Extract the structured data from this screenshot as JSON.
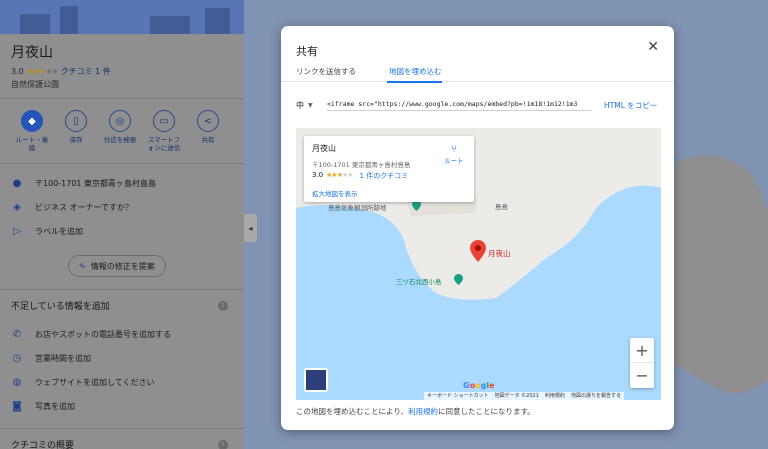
{
  "left_panel": {
    "title": "月夜山",
    "rating": "3.0",
    "review_link": "クチコミ 1 件",
    "category": "自然保護公園",
    "actions": [
      {
        "label_1": "ルート・乗",
        "label_2": "換",
        "icon": "directions-icon"
      },
      {
        "label_1": "保存",
        "label_2": "",
        "icon": "bookmark-icon"
      },
      {
        "label_1": "付近を検索",
        "label_2": "",
        "icon": "nearby-icon"
      },
      {
        "label_1": "スマートフ",
        "label_2": "ォンに送信",
        "icon": "phone-icon"
      },
      {
        "label_1": "共有",
        "label_2": "",
        "icon": "share-icon"
      }
    ],
    "address": "〒100-1701 東京都青ヶ島村島島",
    "owner_prompt": "ビジネス オーナーですか？",
    "add_label": "ラベルを追加",
    "suggest_edit": "情報の修正を提案",
    "missing_info_title": "不足している情報を追加",
    "missing_items": [
      "お店やスポットの電話番号を追加する",
      "営業時間を追加",
      "ウェブサイトを追加してください",
      "写真を追加"
    ],
    "reviews_summary_title": "クチコミの概要"
  },
  "dialog": {
    "title": "共有",
    "tabs": [
      "リンクを送信する",
      "地図を埋め込む"
    ],
    "active_tab": 1,
    "size": "中",
    "embed_code": "<iframe src=\"https://www.google.com/maps/embed?pb=!1m18!1m12!1m3",
    "copy_html": "HTML をコピー",
    "terms_prefix": "この地図を埋め込むことにより、",
    "terms_link": "利用規約",
    "terms_suffix": "に同意したことになります。"
  },
  "map": {
    "card": {
      "title": "月夜山",
      "address": "〒100-1701 東京都青ヶ島村島島",
      "rating": "3.0",
      "reviews": "1 件のクチコミ",
      "route": "ルート",
      "enlarge": "拡大地図を表示"
    },
    "pin_label": "月夜山",
    "labels": {
      "village_office": "島島気象観測所跡地",
      "shimashima": "島島",
      "beach": "三ツ石北西小島"
    },
    "google": "Google",
    "footer": [
      "キーボード ショートカット",
      "地図データ ©2021",
      "利用規約",
      "地図の誤りを報告する"
    ]
  },
  "colors": {
    "accent": "#1a73e8",
    "pin": "#ea4335",
    "star": "#f5a623",
    "water": "#aadaff",
    "land": "#ecebe8"
  }
}
